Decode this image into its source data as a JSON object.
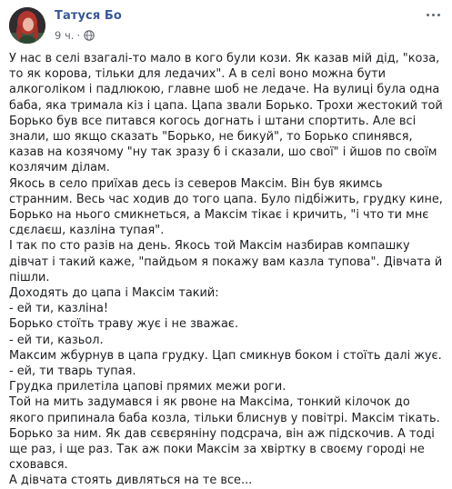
{
  "post": {
    "author": "Татуся Бо",
    "time": "9 ч.",
    "separator": "·",
    "privacy_icon": "globe-icon",
    "more_icon": "more-options-icon",
    "paragraphs": [
      "У нас в селі взагалі-то мало в кого були кози. Як казав мій дід, \"коза, то як корова, тільки для ледачих\". А в селі воно можна бути алкоголіком і падлюкою, главне шоб не ледаче. На вулиці була одна баба, яка тримала кіз і цапа. Цапа звали Борько. Трохи жестокий той Борько був все питався когось догнать і штани спортить. Але всі знали, шо якщо сказать \"Борько, не бикуй\", то Борько спинявся, казав на козячому \"ну так зразу б і сказали, шо свої\" і йшов по своїм козлячим ділам.",
      "Якось в село приїхав десь із северов Максім. Він був якимсь странним. Весь час ходив до того цапа. Було підбіжить, грудку кине, Борько на нього смикнеться, а Максім тікає і кричить, \"і что ти мнє сдєлаєш, казліна тупая\".",
      "І так по сто разів на день. Якось той Максім назбирав компашку дівчат і такий каже, \"пайдьом я покажу вам казла тупова\". Дівчата й пішли.",
      "Доходять до цапа і Максім такий:",
      "- ей ти, казліна!",
      "Борько стоїть траву жує і не зважає.",
      "- ей ти, казьол.",
      "Максим жбурнув в цапа грудку. Цап смикнув боком і стоїть далі жує.",
      "- ей, ти тварь тупая.",
      "Грудка прилетіла цапові прямих межи роги.",
      "Той на мить задумався і як рвоне на Максіма, тонкий кілочок до якого припинала баба козла, тільки блиснув у повітрі. Максім тікать. Борько за ним. Як дав сєвєряніну подсрача, він аж підскочив. А тоді ще раз, і ще раз. Так аж поки Максім за хвіртку в своєму городі не сховався.",
      "А дівчата стоять дивляться на те все..."
    ]
  },
  "colors": {
    "author": "#385898",
    "text": "#1c1e21",
    "meta": "#616770",
    "background": "#ffffff"
  }
}
